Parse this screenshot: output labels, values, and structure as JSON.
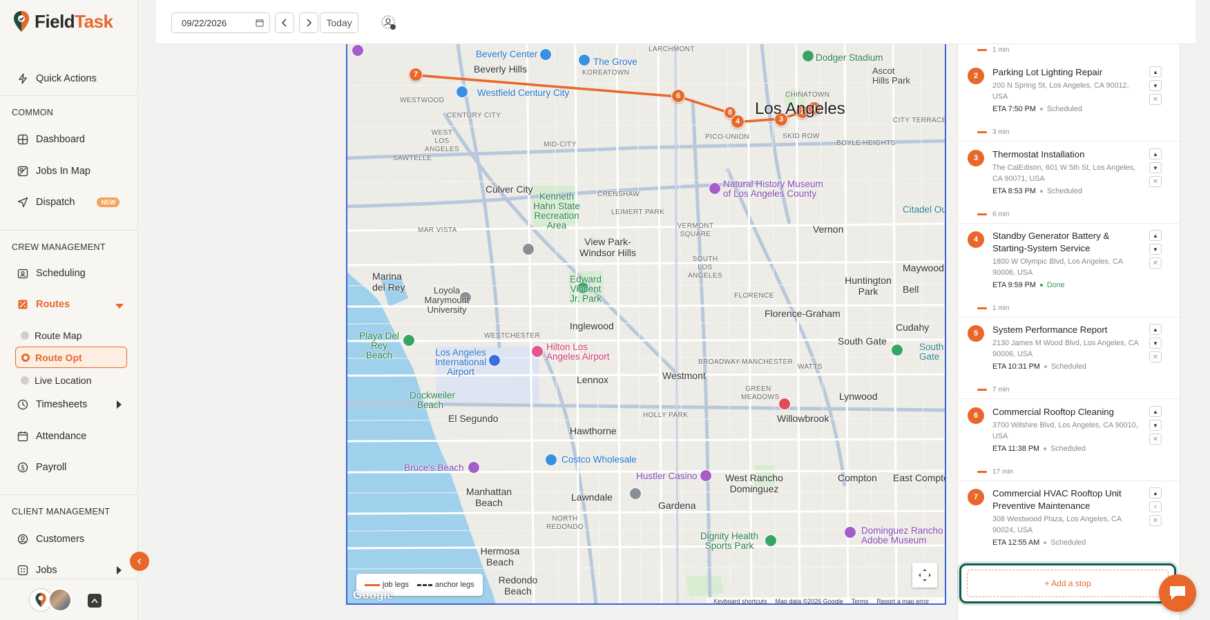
{
  "brand": {
    "part1": "Field",
    "part2": "Task",
    "accent": "#e8672a"
  },
  "sidebar": {
    "quick_actions": "Quick Actions",
    "sections": {
      "common": "COMMON",
      "crew": "CREW MANAGEMENT",
      "client": "CLIENT MANAGEMENT"
    },
    "items": {
      "dashboard": "Dashboard",
      "jobs_in_map": "Jobs In Map",
      "dispatch": "Dispatch",
      "dispatch_badge": "NEW",
      "scheduling": "Scheduling",
      "routes": "Routes",
      "route_map": "Route Map",
      "route_opt": "Route Opt",
      "live_location": "Live Location",
      "timesheets": "Timesheets",
      "attendance": "Attendance",
      "payroll": "Payroll",
      "customers": "Customers",
      "jobs": "Jobs"
    }
  },
  "topbar": {
    "date_value": "09/22/2026",
    "prev_icon": "chevron-left-icon",
    "next_icon": "chevron-right-icon",
    "today_label": "Today",
    "user_icon": "user-settings-icon"
  },
  "map": {
    "labels": {
      "beverly_center": "Beverly Center",
      "the_grove": "The Grove",
      "beverly_hills": "Beverly Hills",
      "larchmont": "LARCHMONT",
      "dodger_stadium": "Dodger Stadium",
      "chinatown": "CHINATOWN",
      "ascot_hills": "Ascot Hills Park",
      "westwood": "WESTWOOD",
      "westfield": "Westfield Century City",
      "koreatown": "KOREATOWN",
      "los_angeles": "Los Angeles",
      "century_city": "CENTURY CITY",
      "pico_union": "PICO-UNION",
      "skid_row": "SKID ROW",
      "city_terrace": "CITY TERRACE",
      "west_la": "WEST LOS ANGELES",
      "mid_city": "MID-CITY",
      "boyle_heights": "BOYLE HEIGHTS",
      "sawtelle": "SAWTELLE",
      "culver_city": "Culver City",
      "kenneth_hahn": "Kenneth Hahn State Recreation Area",
      "crenshaw": "CRENSHAW",
      "natural_history": "Natural History Museum of Los Angeles County",
      "leimert_park": "LEIMERT PARK",
      "citadel": "Citadel Ou",
      "mar_vista": "MAR VISTA",
      "view_park": "View Park-Windsor Hills",
      "vermont_square": "VERMONT SQUARE",
      "vernon": "Vernon",
      "south_la": "SOUTH LOS ANGELES",
      "marina_del_rey": "Marina del Rey",
      "edward_vincent": "Edward Vincent Jr. Park",
      "huntington_park": "Huntington Park",
      "maywood": "Maywood",
      "bell": "Bell",
      "lmu": "Loyola Marymount University",
      "florence": "FLORENCE",
      "florence_graham": "Florence-Graham",
      "inglewood": "Inglewood",
      "cudahy": "Cudahy",
      "playa_del_rey": "Playa Del Rey Beach",
      "westchester": "WESTCHESTER",
      "lax": "Los Angeles International Airport",
      "hilton": "Hilton Los Angeles Airport",
      "south_gate": "South Gate",
      "broadway_manchester": "BROADWAY-MANCHESTER",
      "watts": "WATTS",
      "south_gate_park": "South Gate",
      "westmont": "Westmont",
      "lennox": "Lennox",
      "dockweiler": "Dockweiler Beach",
      "green_meadows": "GREEN MEADOWS",
      "lynwood": "Lynwood",
      "el_segundo": "El Segundo",
      "holly_park": "HOLLY PARK",
      "willowbrook": "Willowbrook",
      "hawthorne": "Hawthorne",
      "costco": "Costco Wholesale",
      "bruces_beach": "Bruce's Beach",
      "hustler": "Hustler Casino",
      "west_rancho": "West Rancho Dominguez",
      "compton": "Compton",
      "east_compton": "East Compton",
      "manhattan_beach": "Manhattan Beach",
      "lawndale": "Lawndale",
      "gardena": "Gardena",
      "north_redondo": "NORTH REDONDO",
      "dignity_health": "Dignity Health Sports Park",
      "dominguez": "Dominguez Rancho Adobe Museum",
      "hermosa": "Hermosa Beach",
      "redondo": "Redondo Beach"
    },
    "legend": {
      "job_legs": "job legs",
      "anchor_legs": "anchor legs"
    },
    "google": "Google",
    "attribution": {
      "shortcuts": "Keyboard shortcuts",
      "data": "Map data ©2026 Google",
      "terms": "Terms",
      "report": "Report a map error"
    },
    "markers": [
      "7",
      "6",
      "8",
      "4",
      "3",
      "2",
      "1"
    ]
  },
  "panel": {
    "top_gap": "1 min",
    "stops": [
      {
        "num": "2",
        "title": "Parking Lot Lighting Repair",
        "addr": "200 N Spring St, Los Angeles, CA 90012, USA",
        "eta": "ETA 7:50 PM",
        "status": "Scheduled",
        "gap_after": "3 min"
      },
      {
        "num": "3",
        "title": "Thermostat Installation",
        "addr": "The CalEdison, 601 W 5th St, Los Angeles, CA 90071, USA",
        "eta": "ETA 8:53 PM",
        "status": "Scheduled",
        "gap_after": "6 min"
      },
      {
        "num": "4",
        "title": "Standby Generator Battery & Starting-System Service",
        "addr": "1800 W Olympic Blvd, Los Angeles, CA 90006, USA",
        "eta": "ETA 9:59 PM",
        "status": "Done",
        "gap_after": "1 min"
      },
      {
        "num": "5",
        "title": "System Performance Report",
        "addr": "2130 James M Wood Blvd, Los Angeles, CA 90006, USA",
        "eta": "ETA 10:31 PM",
        "status": "Scheduled",
        "gap_after": "7 min"
      },
      {
        "num": "6",
        "title": "Commercial Rooftop Cleaning",
        "addr": "3700 Wilshire Blvd, Los Angeles, CA 90010, USA",
        "eta": "ETA 11:38 PM",
        "status": "Scheduled",
        "gap_after": "17 min"
      },
      {
        "num": "7",
        "title": "Commercial HVAC Rooftop Unit Preventive Maintenance",
        "addr": "308 Westwood Plaza, Los Angeles, CA 90024, USA",
        "eta": "ETA 12:55 AM",
        "status": "Scheduled",
        "gap_after": ""
      }
    ],
    "ctrl_up": "▲",
    "ctrl_down": "▼",
    "ctrl_remove": "✕",
    "add_stop": "+ Add a stop"
  },
  "colors": {
    "accent": "#e8672a",
    "map_border": "#3d63d9",
    "add_stop_border": "#0d5c52",
    "done": "#2f9e57"
  }
}
